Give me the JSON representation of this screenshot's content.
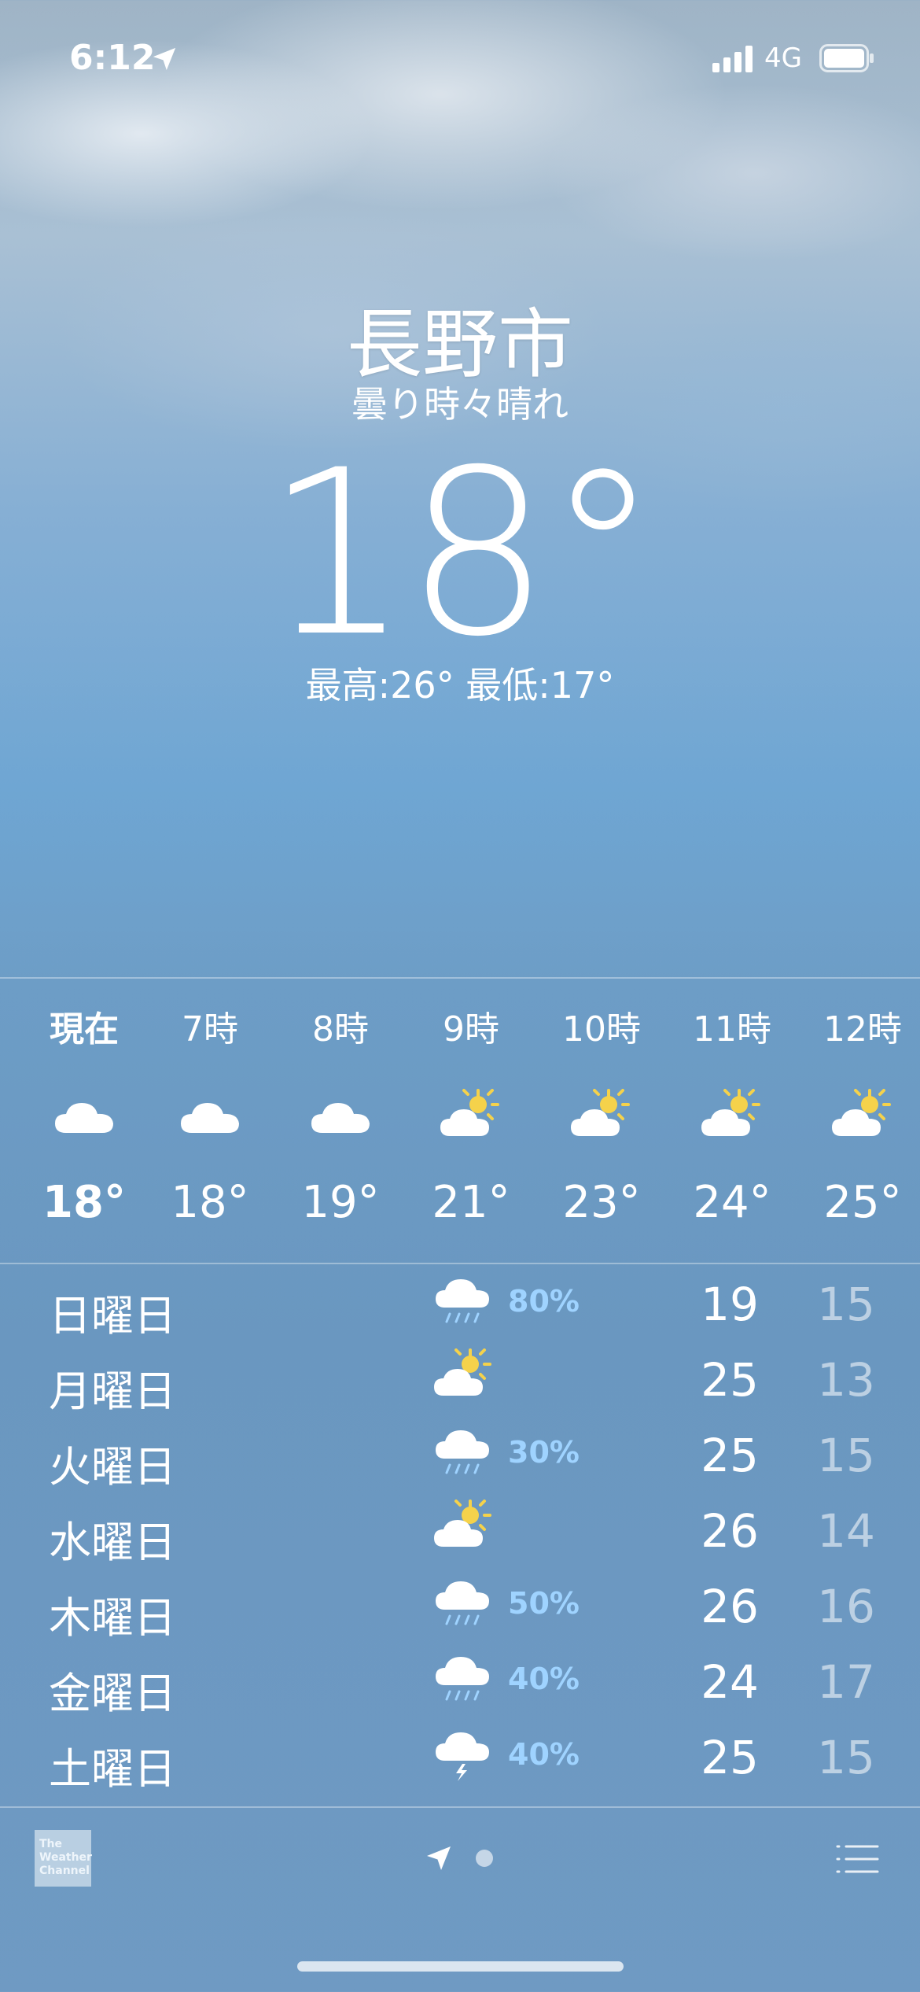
{
  "status_bar": {
    "time": "6:12",
    "network": "4G"
  },
  "header": {
    "city": "長野市",
    "condition": "曇り時々晴れ",
    "temperature": "18",
    "degree": "°",
    "high_low": "最高:26° 最低:17°"
  },
  "hourly": [
    {
      "label": "現在",
      "icon": "cloud-icon",
      "temp": "18°"
    },
    {
      "label": "7時",
      "icon": "cloud-icon",
      "temp": "18°"
    },
    {
      "label": "8時",
      "icon": "cloud-icon",
      "temp": "19°"
    },
    {
      "label": "9時",
      "icon": "partly-sunny-icon",
      "temp": "21°"
    },
    {
      "label": "10時",
      "icon": "partly-sunny-icon",
      "temp": "23°"
    },
    {
      "label": "11時",
      "icon": "partly-sunny-icon",
      "temp": "24°"
    },
    {
      "label": "12時",
      "icon": "partly-sunny-icon",
      "temp": "25°"
    }
  ],
  "daily": [
    {
      "day": "日曜日",
      "icon": "rain-icon",
      "precip": "80%",
      "high": "19",
      "low": "15"
    },
    {
      "day": "月曜日",
      "icon": "partly-sunny-icon",
      "precip": "",
      "high": "25",
      "low": "13"
    },
    {
      "day": "火曜日",
      "icon": "rain-icon",
      "precip": "30%",
      "high": "25",
      "low": "15"
    },
    {
      "day": "水曜日",
      "icon": "partly-sunny-icon",
      "precip": "",
      "high": "26",
      "low": "14"
    },
    {
      "day": "木曜日",
      "icon": "rain-icon",
      "precip": "50%",
      "high": "26",
      "low": "16"
    },
    {
      "day": "金曜日",
      "icon": "rain-icon",
      "precip": "40%",
      "high": "24",
      "low": "17"
    },
    {
      "day": "土曜日",
      "icon": "thunderstorm-icon",
      "precip": "40%",
      "high": "25",
      "low": "15"
    }
  ],
  "footer": {
    "logo_text": "The Weather Channel"
  },
  "colors": {
    "precip": "#9fd3ff",
    "sun": "#f5d24b"
  }
}
